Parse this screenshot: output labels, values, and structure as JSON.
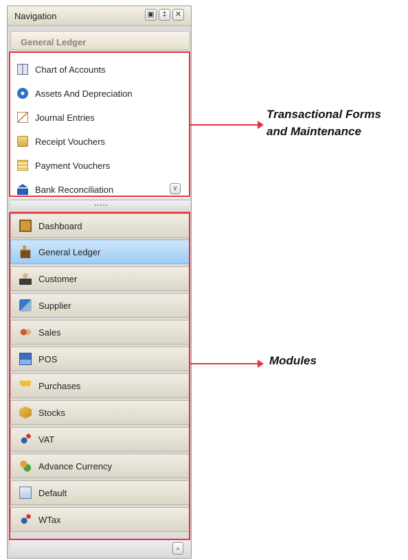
{
  "navigation": {
    "title": "Navigation",
    "header_buttons": [
      "dock-icon",
      "pin-icon",
      "close-icon"
    ],
    "section_title": "General Ledger",
    "items": [
      {
        "label": "Chart of Accounts",
        "icon": "book-icon"
      },
      {
        "label": "Assets And Depreciation",
        "icon": "gear-icon"
      },
      {
        "label": "Journal Entries",
        "icon": "journal-icon"
      },
      {
        "label": "Receipt Vouchers",
        "icon": "receipt-icon"
      },
      {
        "label": "Payment Vouchers",
        "icon": "payment-icon"
      },
      {
        "label": "Bank Reconciliation",
        "icon": "bank-icon"
      }
    ],
    "modules": [
      {
        "label": "Dashboard",
        "icon": "dashboard-icon"
      },
      {
        "label": "General Ledger",
        "icon": "ledger-icon",
        "selected": true
      },
      {
        "label": "Customer",
        "icon": "customer-icon"
      },
      {
        "label": "Supplier",
        "icon": "supplier-icon"
      },
      {
        "label": "Sales",
        "icon": "sales-icon"
      },
      {
        "label": "POS",
        "icon": "pos-icon"
      },
      {
        "label": "Purchases",
        "icon": "purchases-icon"
      },
      {
        "label": "Stocks",
        "icon": "stocks-icon"
      },
      {
        "label": "VAT",
        "icon": "vat-icon"
      },
      {
        "label": "Advance Currency",
        "icon": "currency-icon"
      },
      {
        "label": "Default",
        "icon": "default-icon"
      },
      {
        "label": "WTax",
        "icon": "wtax-icon"
      }
    ]
  },
  "annotations": {
    "transactional_line1": "Transactional Forms",
    "transactional_line2": "and Maintenance",
    "modules": "Modules"
  },
  "colors": {
    "callout_red": "#e8303b",
    "selected_blue": "#9ccdf3"
  }
}
